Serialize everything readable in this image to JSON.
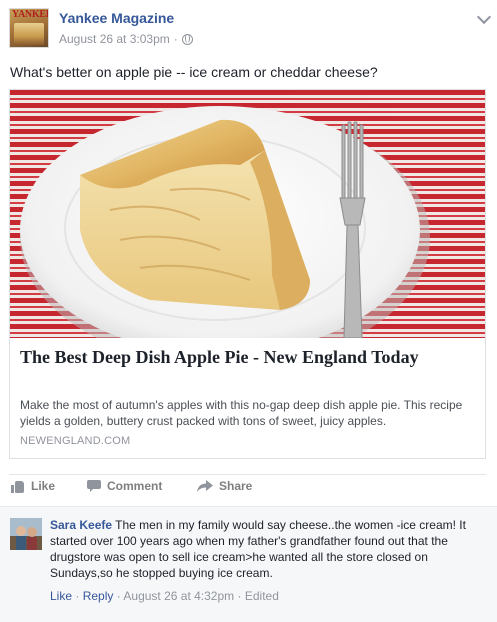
{
  "post": {
    "page_name": "Yankee Magazine",
    "avatar_masthead": "YANKEE",
    "timestamp": "August 26 at 3:03pm",
    "separator": "·",
    "text": "What's better on apple pie -- ice cream or cheddar cheese?"
  },
  "link_card": {
    "title": "The Best Deep Dish Apple Pie - New England Today",
    "description": "Make the most of autumn's apples with this no-gap deep dish apple pie. This recipe yields a golden, buttery crust packed with tons of sweet, juicy apples.",
    "domain": "NEWENGLAND.COM"
  },
  "actions": {
    "like": "Like",
    "comment": "Comment",
    "share": "Share"
  },
  "comment": {
    "author": "Sara Keefe",
    "text": "The men in my family would say cheese..the women -ice cream! It started over 100 years ago when my father's grandfather found out that the drugstore was open to sell ice cream>he wanted all the store closed on Sundays,so he stopped buying ice cream.",
    "like": "Like",
    "reply": "Reply",
    "sep": "·",
    "time": "August 26 at 4:32pm",
    "edited": "Edited"
  },
  "colors": {
    "link_blue": "#365899",
    "meta_gray": "#90949c",
    "text_dark": "#1d2129"
  }
}
